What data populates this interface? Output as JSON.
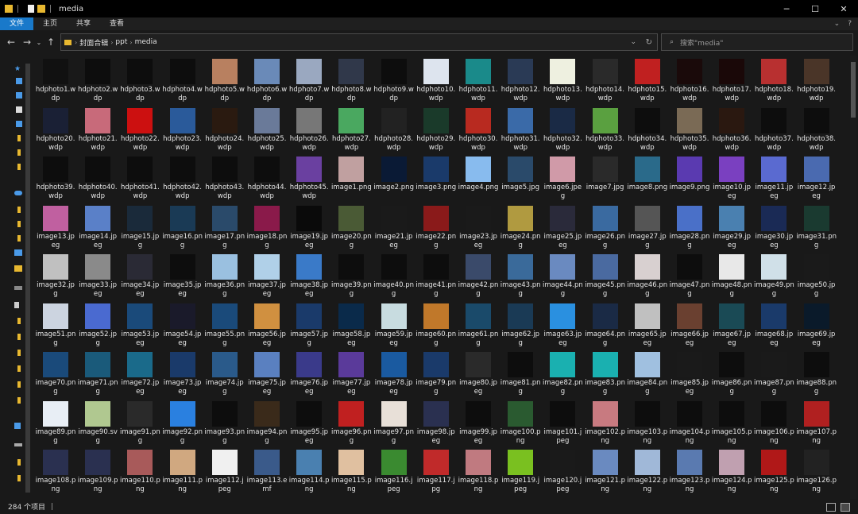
{
  "window": {
    "title": "media",
    "minimize": "─",
    "maximize": "☐",
    "close": "✕"
  },
  "ribbon": {
    "tabs": [
      "文件",
      "主页",
      "共享",
      "查看"
    ],
    "active": 0
  },
  "address": {
    "crumbs": [
      "封面合辑",
      "ppt",
      "media"
    ]
  },
  "search": {
    "placeholder": "搜索\"media\""
  },
  "status": {
    "count": "284 个项目"
  },
  "files": [
    "hdphoto1.wdp",
    "hdphoto2.wdp",
    "hdphoto3.wdp",
    "hdphoto4.wdp",
    "hdphoto5.wdp",
    "hdphoto6.wdp",
    "hdphoto7.wdp",
    "hdphoto8.wdp",
    "hdphoto9.wdp",
    "hdphoto10.wdp",
    "hdphoto11.wdp",
    "hdphoto12.wdp",
    "hdphoto13.wdp",
    "hdphoto14.wdp",
    "hdphoto15.wdp",
    "hdphoto16.wdp",
    "hdphoto17.wdp",
    "hdphoto18.wdp",
    "hdphoto19.wdp",
    "hdphoto20.wdp",
    "hdphoto21.wdp",
    "hdphoto22.wdp",
    "hdphoto23.wdp",
    "hdphoto24.wdp",
    "hdphoto25.wdp",
    "hdphoto26.wdp",
    "hdphoto27.wdp",
    "hdphoto28.wdp",
    "hdphoto29.wdp",
    "hdphoto30.wdp",
    "hdphoto31.wdp",
    "hdphoto32.wdp",
    "hdphoto33.wdp",
    "hdphoto34.wdp",
    "hdphoto35.wdp",
    "hdphoto36.wdp",
    "hdphoto37.wdp",
    "hdphoto38.wdp",
    "hdphoto39.wdp",
    "hdphoto40.wdp",
    "hdphoto41.wdp",
    "hdphoto42.wdp",
    "hdphoto43.wdp",
    "hdphoto44.wdp",
    "hdphoto45.wdp",
    "image1.png",
    "image2.png",
    "image3.png",
    "image4.png",
    "image5.jpg",
    "image6.jpeg",
    "image7.jpg",
    "image8.png",
    "image9.png",
    "image10.jpeg",
    "image11.jpeg",
    "image12.jpeg",
    "image13.jpeg",
    "image14.jpeg",
    "image15.jpg",
    "image16.png",
    "image17.png",
    "image18.png",
    "image19.jpeg",
    "image20.png",
    "image21.jpeg",
    "image22.png",
    "image23.jpeg",
    "image24.png",
    "image25.jpeg",
    "image26.png",
    "image27.jpg",
    "image28.png",
    "image29.jpeg",
    "image30.jpeg",
    "image31.png",
    "image32.jpg",
    "image33.jpeg",
    "image34.jpeg",
    "image35.jpeg",
    "image36.png",
    "image37.jpeg",
    "image38.jpeg",
    "image39.png",
    "image40.png",
    "image41.png",
    "image42.png",
    "image43.png",
    "image44.png",
    "image45.png",
    "image46.png",
    "image47.png",
    "image48.png",
    "image49.png",
    "image50.jpg",
    "image51.png",
    "image52.jpg",
    "image53.jpeg",
    "image54.jpeg",
    "image55.png",
    "image56.jpeg",
    "image57.jpg",
    "image58.jpeg",
    "image59.jpeg",
    "image60.png",
    "image61.png",
    "image62.jpg",
    "image63.jpeg",
    "image64.png",
    "image65.jpeg",
    "image66.jpeg",
    "image67.jpeg",
    "image68.jpeg",
    "image69.jpeg",
    "image70.png",
    "image71.png",
    "image72.jpeg",
    "image73.jpeg",
    "image74.jpg",
    "image75.jpeg",
    "image76.jpeg",
    "image77.jpeg",
    "image78.jpeg",
    "image79.png",
    "image80.jpeg",
    "image81.png",
    "image82.png",
    "image83.png",
    "image84.png",
    "image85.jpeg",
    "image86.png",
    "image87.png",
    "image88.png",
    "image89.png",
    "image90.svg",
    "image91.png",
    "image92.png",
    "image93.png",
    "image94.png",
    "image95.jpeg",
    "image96.png",
    "image97.png",
    "image98.jpeg",
    "image99.jpeg",
    "image100.png",
    "image101.jpeg",
    "image102.png",
    "image103.png",
    "image104.png",
    "image105.png",
    "image106.png",
    "image107.png",
    "image108.png",
    "image109.png",
    "image110.png",
    "image111.png",
    "image112.jpeg",
    "image113.emf",
    "image114.png",
    "image115.png",
    "image116.jpeg",
    "image117.jpg",
    "image118.png",
    "image119.jpeg",
    "image120.jpeg",
    "image121.png",
    "image122.png",
    "image123.png",
    "image124.png",
    "image125.png",
    "image126.png"
  ],
  "thumb_colors": [
    "#111111",
    "#0d0d0d",
    "#0d0d0d",
    "#0d0d0d",
    "#b88060",
    "#6a8ab8",
    "#9aa8c0",
    "#30384a",
    "#0d0d0d",
    "#dde4ee",
    "#1a8a8a",
    "#2a3a55",
    "#eef0e0",
    "#2a2a2a",
    "#c02020",
    "#1a0a0a",
    "#1a0808",
    "#b83030",
    "#4a3528",
    "#1a2035",
    "#c86a7a",
    "#cc1010",
    "#2a5a9a",
    "#2a1a10",
    "#6a7a99",
    "#777777",
    "#4aa860",
    "#222222",
    "#1a3a2a",
    "#b82a20",
    "#3a6aa8",
    "#1a2a45",
    "#5aa040",
    "#0d0d0d",
    "#7a6a55",
    "#2a1810",
    "#0d0d0d",
    "#0d0d0d",
    "#0d0d0d",
    "#0d0d0d",
    "#0d0d0d",
    "#0d0d0d",
    "#0d0d0d",
    "#0d0d0d",
    "#6a40a0",
    "#c0a0a0",
    "#0a1a35",
    "#1a3a6a",
    "#88bbee",
    "#2a4a6a",
    "#d09aa8",
    "#2a2a2a",
    "#2a6a8a",
    "#5a3ab0",
    "#7a40c0",
    "#5a6ad0",
    "#4a6ab0",
    "#c060a0",
    "#5a80c8",
    "#1a2a3a",
    "#1a3a55",
    "#2a4a6a",
    "#8a1a4a",
    "#0a0a0a",
    "#4a5a35",
    "#1a1a1a",
    "#8a1a1a",
    "#1a1a1a",
    "#b09a40",
    "#2a2a3a",
    "#3a6aa0",
    "#555555",
    "#4a70c8",
    "#4a80b0",
    "#1a2a55",
    "#1a3a30",
    "#c0c0c0",
    "#8a8a8a",
    "#2a2a35",
    "#0d0d0d",
    "#9ac0e0",
    "#b0d0e8",
    "#3a7ac8",
    "#0d0d0d",
    "#0d0d0d",
    "#0d0d0d",
    "#3a4a6a",
    "#3a6a9a",
    "#6a8ac0",
    "#4a6aa0",
    "#d8d0d0",
    "#0d0d0d",
    "#e8e8e8",
    "#d0e0e8",
    "#1a1a1a",
    "#ccd4e0",
    "#4a6ad0",
    "#1a4a7a",
    "#1a1a2a",
    "#1a4a7a",
    "#d09040",
    "#1a3a6a",
    "#0a2a4a",
    "#c8dce0",
    "#c0782a",
    "#1a4a6a",
    "#1a3a55",
    "#2a90e0",
    "#1a2a45",
    "#c0c0c0",
    "#6a4030",
    "#1a4a55",
    "#1a3a6a",
    "#0a1a2a",
    "#1a4a7a",
    "#1a5a7a",
    "#1a6a8a",
    "#1a3a6a",
    "#2a5a8a",
    "#5a80c0",
    "#3a3a8a",
    "#5a3a9a",
    "#1a5aa0",
    "#1a3a6a",
    "#2a2a2a",
    "#0d0d0d",
    "#1ab0b0",
    "#1ab0b0",
    "#a0c0e0",
    "#1a1a1a",
    "#0d0d0d",
    "#1a1a1a",
    "#0d0d0d",
    "#e8eef5",
    "#b0c890",
    "#2a2a2a",
    "#2a80e0",
    "#0d0d0d",
    "#3a2a1a",
    "#0d0d0d",
    "#c02020",
    "#e8e0d8",
    "#2a3050",
    "#0d0d0d",
    "#2a5a30",
    "#0d0d0d",
    "#c87a80",
    "#0d0d0d",
    "#0d0d0d",
    "#0d0d0d",
    "#0d0d0d",
    "#b02020",
    "#2a3050",
    "#2a3050",
    "#a85a5a",
    "#d0a880",
    "#f0f0f0",
    "#3a5a8a",
    "#4a80b0",
    "#e0c0a0",
    "#3a8a30",
    "#c02a2a",
    "#c07a80",
    "#7ac020",
    "#1a1a1a",
    "#6a8ac0",
    "#a0b8d8",
    "#5a7ab0",
    "#c0a0b0",
    "#b01818"
  ]
}
